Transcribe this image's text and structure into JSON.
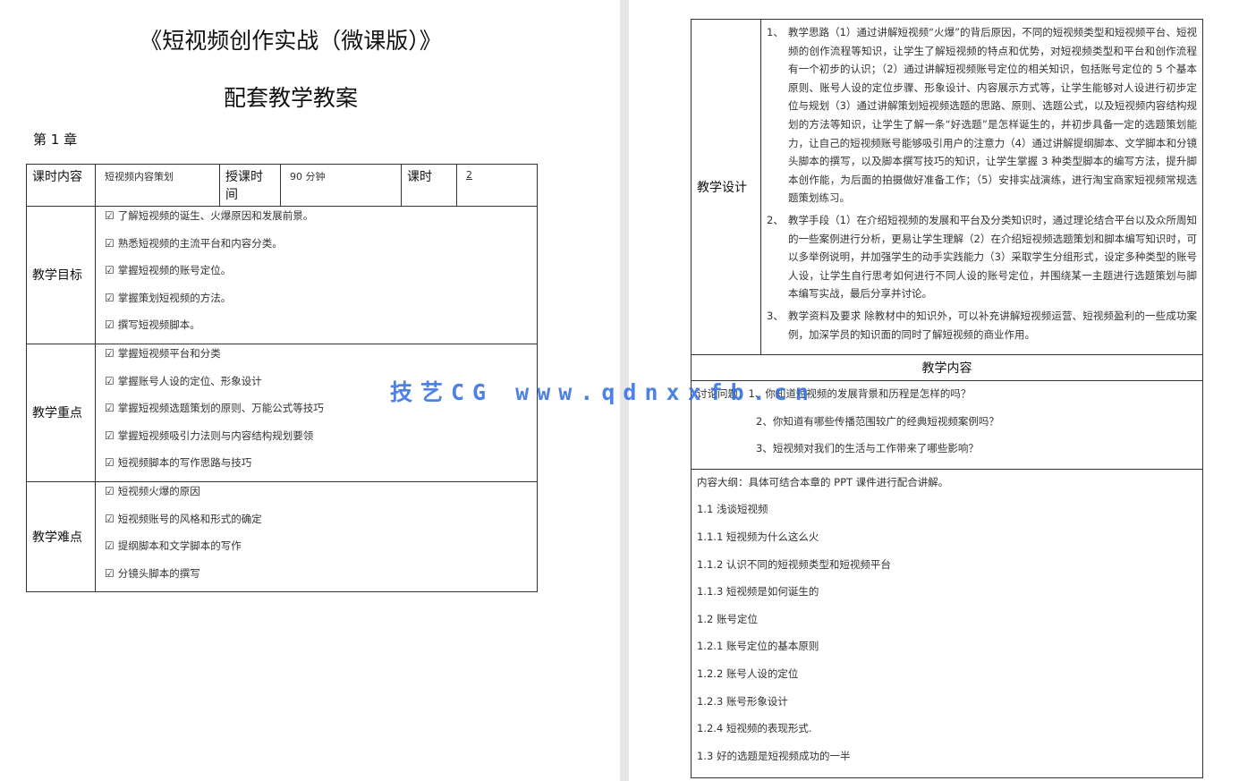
{
  "left_page": {
    "title_line1": "《短视频创作实战（微课版）》",
    "title_line2": "配套教学教案",
    "chapter": "第 1 章",
    "header_row": {
      "content_label": "课时内容",
      "content_value": "短视频内容策划",
      "time_label": "授课时间",
      "time_value": "90 分钟",
      "hours_label": "课时",
      "hours_value": "2"
    },
    "checkbox_glyph": "☑",
    "goals": {
      "label": "教学目标",
      "items": [
        "了解短视频的诞生、火爆原因和发展前景。",
        "熟悉短视频的主流平台和内容分类。",
        "掌握短视频的账号定位。",
        "掌握策划短视频的方法。",
        "撰写短视频脚本。"
      ]
    },
    "key_points": {
      "label": "教学重点",
      "items": [
        "掌握短视频平台和分类",
        "掌握账号人设的定位、形象设计",
        "掌握短视频选题策划的原则、万能公式等技巧",
        "掌握短视频吸引力法则与内容结构规划要领",
        "短视频脚本的写作思路与技巧"
      ]
    },
    "difficulties": {
      "label": "教学难点",
      "items": [
        "短视频火爆的原因",
        "短视频账号的风格和形式的确定",
        "提纲脚本和文学脚本的写作",
        "分镜头脚本的撰写"
      ]
    }
  },
  "right_page": {
    "design": {
      "label": "教学设计",
      "paragraphs": [
        {
          "num": "1、",
          "text": "教学思路（1）通过讲解短视频“火爆”的背后原因，不同的短视频类型和短视频平台、短视频的创作流程等知识，让学生了解短视频的特点和优势，对短视频类型和平台和创作流程有一个初步的认识；（2）通过讲解短视频账号定位的相关知识，包括账号定位的 5 个基本原则、账号人设的定位步骤、形象设计、内容展示方式等，让学生能够对人设进行初步定位与规划（3）通过讲解策划短视频选题的思路、原则、选题公式，以及短视频内容结构规划的方法等知识，让学生了解一条“好选题”是怎样诞生的，并初步具备一定的选题策划能力，让自己的短视频账号能够吸引用户的注意力（4）通过讲解提纲脚本、文学脚本和分镜头脚本的撰写，以及脚本撰写技巧的知识，让学生掌握 3 种类型脚本的编写方法，提升脚本创作能，为后面的拍摄做好准备工作；（5）安排实战演练，进行淘宝商家短视频常规选题策划练习。"
        },
        {
          "num": "2、",
          "text": "教学手段（1）在介绍短视频的发展和平台及分类知识时，通过理论结合平台以及众所周知的一些案例进行分析，更易让学生理解（2）在介绍短视频选题策划和脚本编写知识时，可以多举例说明，并加强学生的动手实践能力（3）采取学生分组形式，设定多种类型的账号人设，让学生自行思考如何进行不同人设的账号定位，并围绕某一主题进行选题策划与脚本编写实战，最后分享并讨论。"
        },
        {
          "num": "3、",
          "text": "教学资料及要求 除教材中的知识外，可以补充讲解短视频运营、短视频盈利的一些成功案例，加深学员的知识面的同时了解短视频的商业作用。"
        }
      ]
    },
    "content_header": "教学内容",
    "discussion": {
      "label": "讨论问题：",
      "items": [
        "1、你知道短视频的发展背景和历程是怎样的吗？",
        "2、你知道有哪些传播范围较广的经典短视频案例吗？",
        "3、短视频对我们的生活与工作带来了哪些影响？"
      ]
    },
    "outline": {
      "intro": "内容大纲：具体可结合本章的 PPT 课件进行配合讲解。",
      "items": [
        "1.1  浅谈短视频",
        "1.1.1  短视频为什么这么火",
        "1.1.2  认识不同的短视频类型和短视频平台",
        "1.1.3  短视频是如何诞生的",
        "1.2  账号定位",
        "1.2.1  账号定位的基本原则",
        "1.2.2  账号人设的定位",
        "1.2.3  账号形象设计",
        "1.2.4  短视频的表现形式.",
        "1.3  好的选题是短视频成功的一半"
      ]
    }
  },
  "watermark": "技艺CG  www.qdnxxfb.cn"
}
